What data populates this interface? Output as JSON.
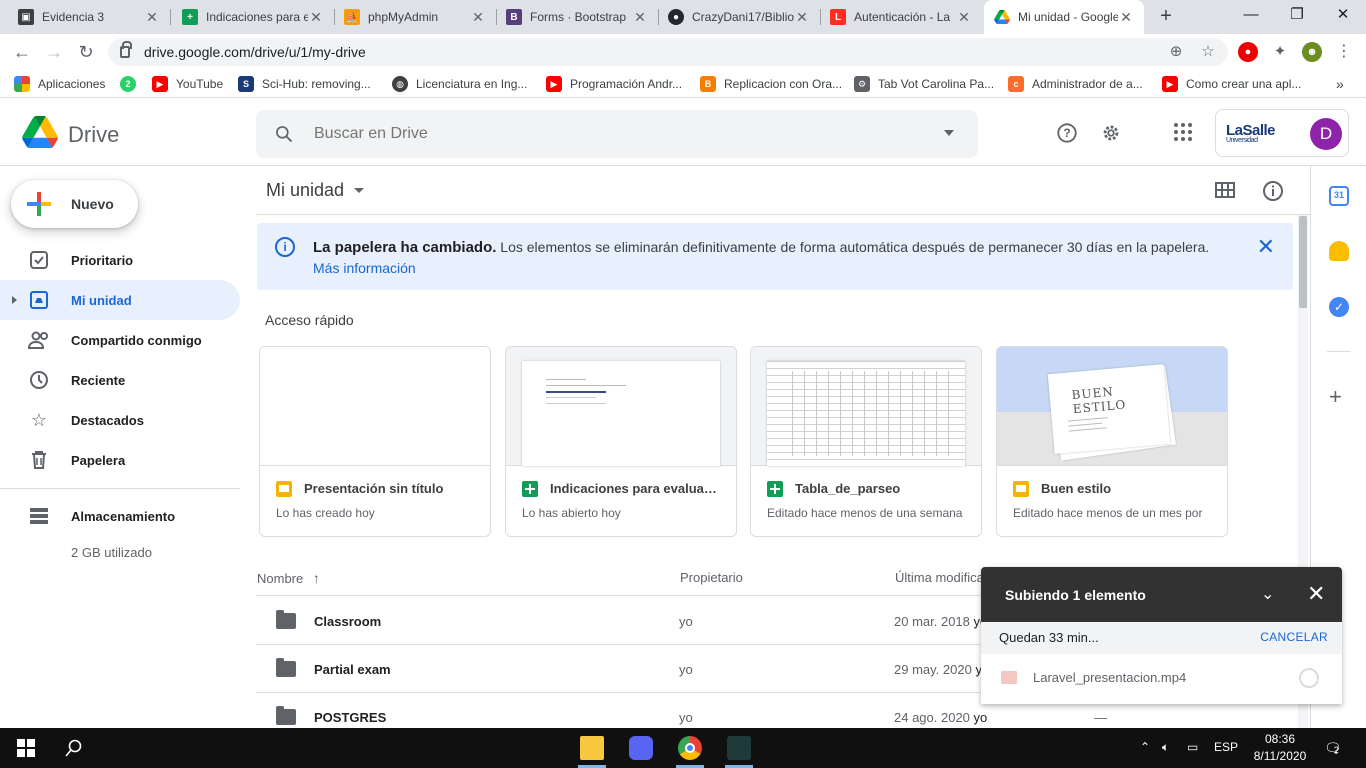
{
  "browser": {
    "tabs": [
      {
        "title": "Evidencia 3",
        "icon": "classroom-icon",
        "color": "#3c4043"
      },
      {
        "title": "Indicaciones para e",
        "icon": "sheets-icon",
        "color": "#0f9d58"
      },
      {
        "title": "phpMyAdmin",
        "icon": "phpmyadmin-icon",
        "color": "#f89c0e"
      },
      {
        "title": "Forms · Bootstrap",
        "icon": "bootstrap-icon",
        "color": "#563d7c"
      },
      {
        "title": "CrazyDani17/Biblio",
        "icon": "github-icon",
        "color": "#24292e"
      },
      {
        "title": "Autenticación - La",
        "icon": "laravel-icon",
        "color": "#ff2d20"
      },
      {
        "title": "Mi unidad - Google",
        "icon": "drive-icon",
        "color": "#1a73e8"
      }
    ],
    "url": "drive.google.com/drive/u/1/my-drive",
    "bookmarks": [
      {
        "label": "Aplicaciones",
        "icon": "apps-grid-icon",
        "color": "#4285f4"
      },
      {
        "label": "",
        "icon": "whatsapp-icon",
        "color": "#25d366",
        "badge": "2"
      },
      {
        "label": "YouTube",
        "icon": "youtube-icon",
        "color": "#ff0000"
      },
      {
        "label": "Sci-Hub: removing...",
        "icon": "scihub-icon",
        "color": "#1a3a7a"
      },
      {
        "label": "Licenciatura en Ing...",
        "icon": "globe-icon",
        "color": "#3c4043"
      },
      {
        "label": "Programación Andr...",
        "icon": "youtube-icon",
        "color": "#ff0000"
      },
      {
        "label": "Replicacion con Ora...",
        "icon": "blogger-icon",
        "color": "#f57d00"
      },
      {
        "label": "Tab Vot Carolina Pa...",
        "icon": "tab-icon",
        "color": "#5f6368"
      },
      {
        "label": "Administrador de a...",
        "icon": "cpanel-icon",
        "color": "#ff6c2c"
      },
      {
        "label": "Como crear una apl...",
        "icon": "youtube-icon",
        "color": "#ff0000"
      }
    ]
  },
  "drive": {
    "title": "Drive",
    "search_placeholder": "Buscar en Drive",
    "org_name": "LaSalle",
    "org_sub": "Universidad",
    "avatar_letter": "D"
  },
  "nav": {
    "new_label": "Nuevo",
    "items": [
      {
        "label": "Prioritario",
        "icon": "check-box-icon"
      },
      {
        "label": "Mi unidad",
        "icon": "my-drive-icon"
      },
      {
        "label": "Compartido conmigo",
        "icon": "people-icon"
      },
      {
        "label": "Reciente",
        "icon": "clock-icon"
      },
      {
        "label": "Destacados",
        "icon": "star-icon"
      },
      {
        "label": "Papelera",
        "icon": "trash-icon"
      }
    ],
    "storage_label": "Almacenamiento",
    "storage_used": "2 GB utilizado"
  },
  "main": {
    "breadcrumb": "Mi unidad",
    "banner": {
      "bold": "La papelera ha cambiado.",
      "text": " Los elementos se eliminarán definitivamente de forma automática después de permanecer 30 días en la papelera. ",
      "link": "Más información"
    },
    "quick_access_title": "Acceso rápido",
    "cards": [
      {
        "name": "Presentación sin título",
        "sub": "Lo has creado hoy",
        "type": "slides"
      },
      {
        "name": "Indicaciones para evaluación",
        "sub": "Lo has abierto hoy",
        "type": "sheets"
      },
      {
        "name": "Tabla_de_parseo",
        "sub": "Editado hace menos de una semana",
        "type": "sheets"
      },
      {
        "name": "Buen estilo",
        "sub": "Editado hace menos de un mes por",
        "type": "slides",
        "thumb_text": "Buen estilo"
      }
    ],
    "columns": {
      "name": "Nombre",
      "owner": "Propietario",
      "modified": "Última modificación"
    },
    "rows": [
      {
        "name": "Classroom",
        "owner": "yo",
        "date": "20 mar. 2018",
        "by": "yo",
        "size": ""
      },
      {
        "name": "Partial exam",
        "owner": "yo",
        "date": "29 may. 2020",
        "by": "yo",
        "size": ""
      },
      {
        "name": "POSTGRES",
        "owner": "yo",
        "date": "24 ago. 2020",
        "by": "yo",
        "size": "—"
      }
    ]
  },
  "upload": {
    "title": "Subiendo 1 elemento",
    "remaining": "Quedan 33 min...",
    "cancel": "CANCELAR",
    "file": "Laravel_presentacion.mp4"
  },
  "taskbar": {
    "lang": "ESP",
    "time": "08:36",
    "date": "8/11/2020",
    "notifications": "2"
  }
}
